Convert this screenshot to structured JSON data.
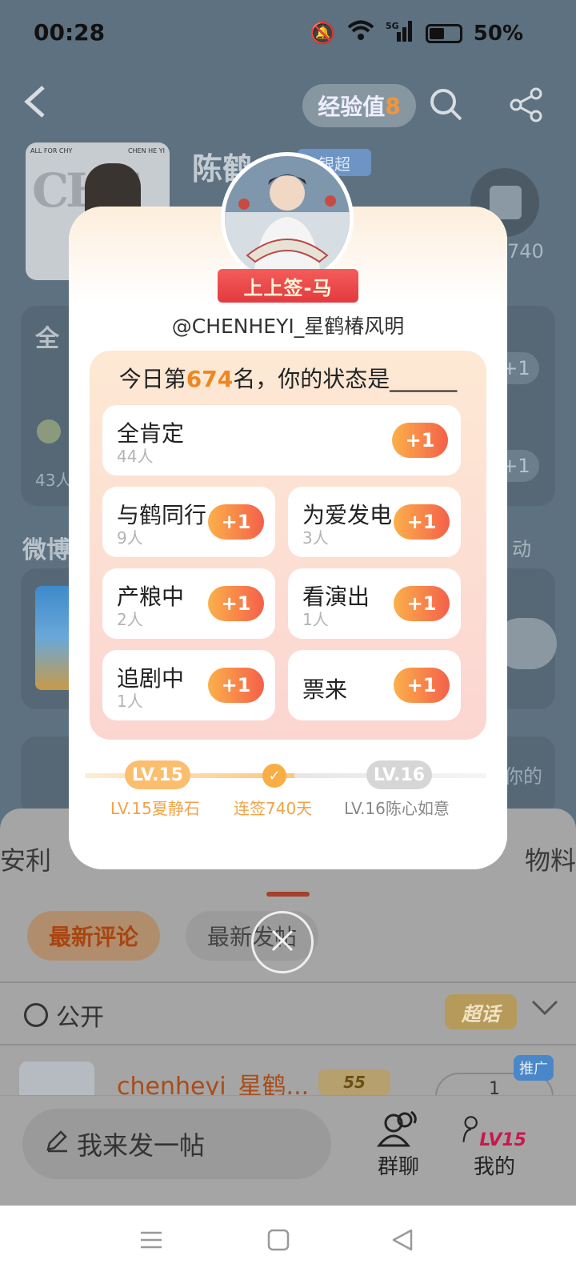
{
  "status_bar": {
    "time": "00:28",
    "battery": "50%",
    "network": "5G"
  },
  "header": {
    "exp_label": "经验值",
    "exp_value": "8"
  },
  "background": {
    "name": "陈鹤",
    "tag": "银超",
    "count_frag": "740",
    "section_title": "微博",
    "count_43": "43人",
    "dong": "动",
    "card_title": "全",
    "look": "看你的",
    "cover_text_left": "ALL FOR CHY",
    "cover_text_right": "CHEN HE YI"
  },
  "sheet": {
    "tab_left": "安利",
    "tab_right": "物料",
    "chip_latest": "最新评论",
    "chip_post": "最新发帖",
    "visibility": "公开",
    "chaohua": "超话",
    "post_name": "chenheyi_星鹤...",
    "post_badge": "55",
    "promo": "推广",
    "side_count": "1"
  },
  "bottom_bar": {
    "compose": "我来发一帖",
    "group_chat": "群聊",
    "mine": "我的",
    "level_badge": "LV15"
  },
  "modal": {
    "ribbon": "上上签-马",
    "handle": "@CHENHEYI_星鹤椿风明",
    "question_prefix": "今日第",
    "rank": "674",
    "question_suffix": "名，你的状态是______",
    "plus_label": "+1",
    "options": [
      {
        "name": "全肯定",
        "count": "44人"
      },
      {
        "name": "与鹤同行",
        "count": "9人"
      },
      {
        "name": "为爱发电",
        "count": "3人"
      },
      {
        "name": "产粮中",
        "count": "2人"
      },
      {
        "name": "看演出",
        "count": "1人"
      },
      {
        "name": "追剧中",
        "count": "1人"
      },
      {
        "name": "票来",
        "count": ""
      }
    ],
    "progress": {
      "current_level": "LV.15",
      "next_level": "LV.16",
      "current_label": "LV.15夏静石",
      "streak_label": "连签740天",
      "next_label": "LV.16陈心如意"
    }
  },
  "colors": {
    "accent_orange": "#f0861f",
    "plus_gradient_start": "#fbb04a",
    "plus_gradient_end": "#f4604a",
    "ribbon_red": "#e33a3f"
  }
}
